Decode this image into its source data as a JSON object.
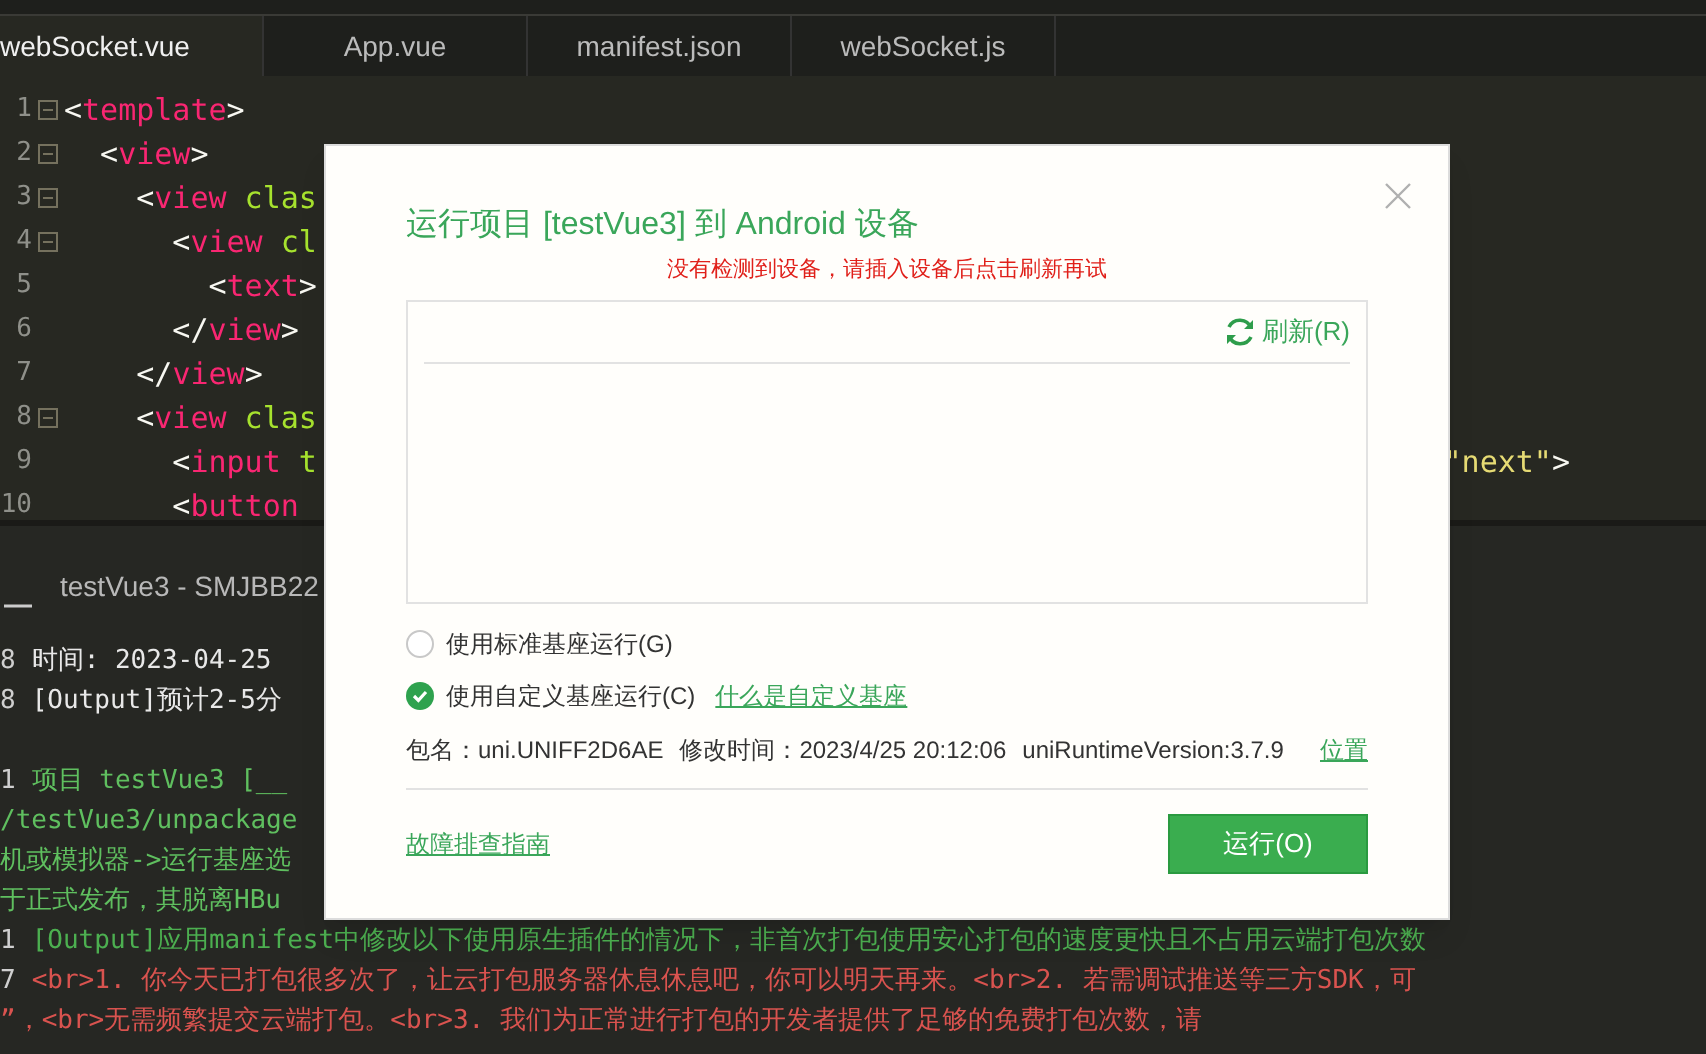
{
  "tabs": [
    {
      "label": "webSocket.vue",
      "selected": true
    },
    {
      "label": "App.vue",
      "selected": false
    },
    {
      "label": "manifest.json",
      "selected": false
    },
    {
      "label": "webSocket.js",
      "selected": false
    }
  ],
  "code": {
    "lines": [
      {
        "number": "1",
        "fold": true,
        "tokens": [
          {
            "kind": "punct",
            "text": "<"
          },
          {
            "kind": "tag",
            "text": "template"
          },
          {
            "kind": "punct",
            "text": ">"
          }
        ]
      },
      {
        "number": "2",
        "fold": true,
        "tokens": [
          {
            "kind": "punct",
            "text": "  <"
          },
          {
            "kind": "tag",
            "text": "view"
          },
          {
            "kind": "punct",
            "text": ">"
          }
        ]
      },
      {
        "number": "3",
        "fold": true,
        "tokens": [
          {
            "kind": "punct",
            "text": "    <"
          },
          {
            "kind": "tag",
            "text": "view"
          },
          {
            "kind": "attr",
            "text": " clas"
          }
        ]
      },
      {
        "number": "4",
        "fold": true,
        "tokens": [
          {
            "kind": "punct",
            "text": "      <"
          },
          {
            "kind": "tag",
            "text": "view"
          },
          {
            "kind": "attr",
            "text": " cl"
          }
        ]
      },
      {
        "number": "5",
        "fold": false,
        "tokens": [
          {
            "kind": "punct",
            "text": "        <"
          },
          {
            "kind": "tag",
            "text": "text"
          },
          {
            "kind": "punct",
            "text": ">"
          }
        ]
      },
      {
        "number": "6",
        "fold": false,
        "tokens": [
          {
            "kind": "punct",
            "text": "      </"
          },
          {
            "kind": "tag",
            "text": "view"
          },
          {
            "kind": "punct",
            "text": ">"
          }
        ]
      },
      {
        "number": "7",
        "fold": false,
        "tokens": [
          {
            "kind": "punct",
            "text": "    </"
          },
          {
            "kind": "tag",
            "text": "view"
          },
          {
            "kind": "punct",
            "text": ">"
          }
        ]
      },
      {
        "number": "8",
        "fold": true,
        "tokens": [
          {
            "kind": "punct",
            "text": "    <"
          },
          {
            "kind": "tag",
            "text": "view"
          },
          {
            "kind": "attr",
            "text": " clas"
          }
        ]
      },
      {
        "number": "9",
        "fold": false,
        "tokens": [
          {
            "kind": "punct",
            "text": "      <"
          },
          {
            "kind": "tag",
            "text": "input"
          },
          {
            "kind": "attr",
            "text": " t"
          }
        ],
        "right_tokens": [
          {
            "kind": "string",
            "text": "\"next\""
          },
          {
            "kind": "punct",
            "text": ">"
          }
        ]
      },
      {
        "number": "10",
        "fold": false,
        "tokens": [
          {
            "kind": "punct",
            "text": "      <"
          },
          {
            "kind": "tag",
            "text": "button"
          }
        ]
      }
    ]
  },
  "console": {
    "title": "testVue3 - SMJBB22",
    "lines": [
      {
        "number": "8",
        "text": "时间: 2023-04-25",
        "color": "#e8e8e8"
      },
      {
        "number": "8",
        "text": "[Output]预计2-5分",
        "color": "#e8e8e8"
      },
      {
        "number": "1",
        "text": "项目 testVue3 [__",
        "color": "#5fbf5f"
      },
      {
        "text": "/testVue3/unpackage",
        "color": "#5fbf5f"
      },
      {
        "text": "机或模拟器->运行基座选",
        "color": "#5fbf5f"
      },
      {
        "text": "于正式发布，其脱离HBu",
        "color": "#5fbf5f"
      },
      {
        "number": "1",
        "text": "[Output]应用manifest中修改以下使用原生插件的情况下，非首次打包使用安心打包的速度更快且不占用云端打包次数",
        "color": "#4caf50"
      },
      {
        "number": "7",
        "text": "<br>1. 你今天已打包很多次了，让云打包服务器休息休息吧，你可以明天再来。<br>2. 若需调试推送等三方SDK，可",
        "color": "#d9534f"
      },
      {
        "text": "”，<br>无需频繁提交云端打包。<br>3. 我们为正常进行打包的开发者提供了足够的免费打包次数，请",
        "color": "#d9534f"
      }
    ]
  },
  "dialog": {
    "title": "运行项目 [testVue3] 到 Android 设备",
    "warning": "没有检测到设备，请插入设备后点击刷新再试",
    "refresh": "刷新(R)",
    "options": [
      {
        "label": "使用标准基座运行(G)",
        "selected": false
      },
      {
        "label": "使用自定义基座运行(C)",
        "selected": true,
        "link": "什么是自定义基座"
      }
    ],
    "info": [
      "包名：uni.UNIFF2D6AE",
      "修改时间：2023/4/25 20:12:06",
      "uniRuntimeVersion:3.7.9"
    ],
    "info_link": "位置",
    "help_link": "故障排查指南",
    "run_button": "运行(O)"
  }
}
